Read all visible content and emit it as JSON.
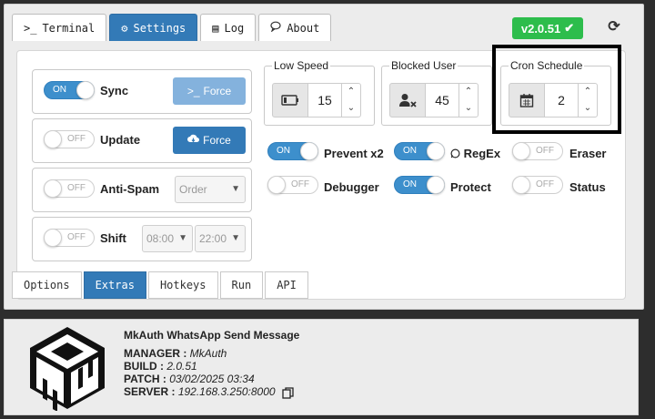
{
  "tabs_top": [
    {
      "icon": "terminal-icon",
      "glyph": ">_",
      "label": "Terminal",
      "active": false
    },
    {
      "icon": "gears-icon",
      "glyph": "⚙",
      "label": "Settings",
      "active": true
    },
    {
      "icon": "list-icon",
      "glyph": "▤",
      "label": "Log",
      "active": false
    },
    {
      "icon": "comment-icon",
      "glyph": "💬",
      "label": "About",
      "active": false
    }
  ],
  "version": "v2.0.51",
  "rows": [
    {
      "label": "Sync",
      "toggle": "ON",
      "button": "Force"
    },
    {
      "label": "Update",
      "toggle": "OFF",
      "button": "Force"
    },
    {
      "label": "Anti-Spam",
      "toggle": "OFF",
      "select": "Order"
    },
    {
      "label": "Shift",
      "toggle": "OFF",
      "select_a": "08:00",
      "select_b": "22:00"
    }
  ],
  "spinners": [
    {
      "legend": "Low Speed",
      "value": "15",
      "icon": "battery-icon"
    },
    {
      "legend": "Blocked User",
      "value": "45",
      "icon": "user-block-icon"
    },
    {
      "legend": "Cron Schedule",
      "value": "2",
      "icon": "calendar-icon"
    }
  ],
  "options": [
    {
      "label": "Prevent x2",
      "toggle": "ON"
    },
    {
      "label": "RegEx",
      "toggle": "ON"
    },
    {
      "label": "Eraser",
      "toggle": "OFF"
    },
    {
      "label": "Debugger",
      "toggle": "OFF"
    },
    {
      "label": "Protect",
      "toggle": "ON"
    },
    {
      "label": "Status",
      "toggle": "OFF"
    }
  ],
  "tabs_bottom": [
    {
      "label": "Options",
      "active": false
    },
    {
      "label": "Extras",
      "active": true
    },
    {
      "label": "Hotkeys",
      "active": false
    },
    {
      "label": "Run",
      "active": false
    },
    {
      "label": "API",
      "active": false
    }
  ],
  "footer": {
    "title": "MkAuth WhatsApp Send Message",
    "manager_key": "MANAGER :",
    "manager_val": "MkAuth",
    "build_key": "BUILD :",
    "build_val": "2.0.51",
    "patch_key": "PATCH :",
    "patch_val": "03/02/2025 03:34",
    "server_key": "SERVER :",
    "server_val": "192.168.3.250:8000"
  },
  "colors": {
    "primary": "#337ab7",
    "success": "#2dbd4c",
    "toggle_on": "#3d8fcc"
  }
}
